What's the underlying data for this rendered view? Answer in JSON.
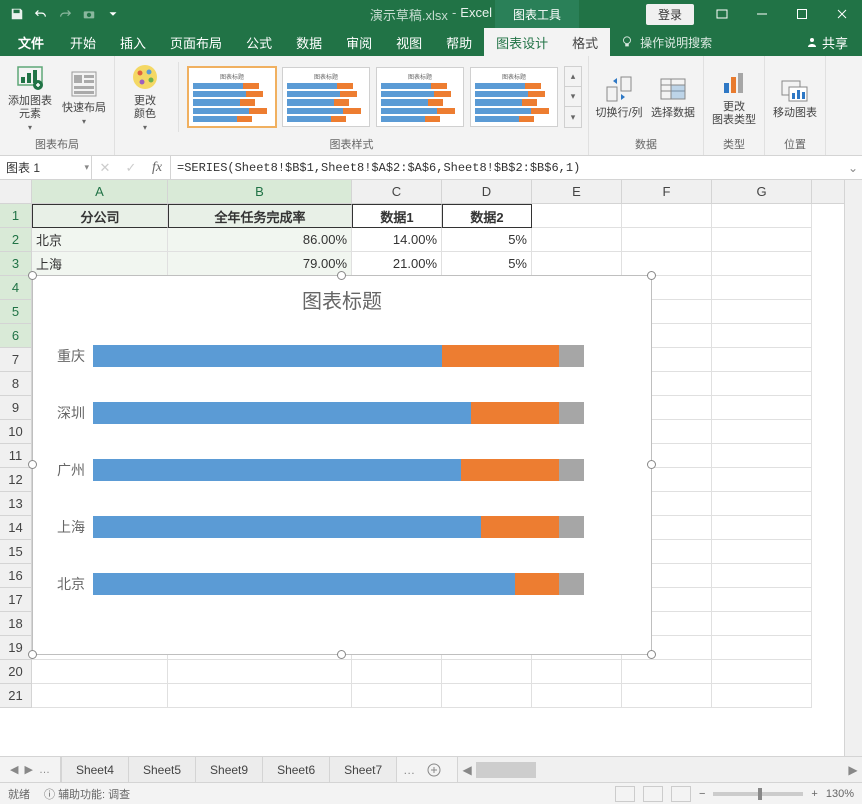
{
  "titlebar": {
    "filename": "演示草稿.xlsx",
    "app": "Excel",
    "chart_tools": "图表工具",
    "login": "登录"
  },
  "tabs": {
    "file": "文件",
    "home": "开始",
    "insert": "插入",
    "layout": "页面布局",
    "formulas": "公式",
    "data": "数据",
    "review": "审阅",
    "view": "视图",
    "help": "帮助",
    "chart_design": "图表设计",
    "format": "格式",
    "tell_me": "操作说明搜索",
    "share": "共享"
  },
  "ribbon": {
    "add_element": "添加图表\n元素",
    "quick_layout": "快速布局",
    "change_colors": "更改\n颜色",
    "switch_rowcol": "切换行/列",
    "select_data": "选择数据",
    "change_type": "更改\n图表类型",
    "move_chart": "移动图表",
    "group_layout": "图表布局",
    "group_styles": "图表样式",
    "group_data": "数据",
    "group_type": "类型",
    "group_location": "位置"
  },
  "formula_bar": {
    "name_box": "图表 1",
    "formula": "=SERIES(Sheet8!$B$1,Sheet8!$A$2:$A$6,Sheet8!$B$2:$B$6,1)"
  },
  "columns": [
    "A",
    "B",
    "C",
    "D",
    "E",
    "F",
    "G"
  ],
  "rows": [
    "1",
    "2",
    "3",
    "4",
    "5",
    "6",
    "7",
    "8",
    "9",
    "10",
    "11",
    "12",
    "13",
    "14",
    "15",
    "16",
    "17",
    "18",
    "19",
    "20",
    "21"
  ],
  "table": {
    "headers": [
      "分公司",
      "全年任务完成率",
      "数据1",
      "数据2"
    ],
    "r2": [
      "北京",
      "86.00%",
      "14.00%",
      "5%"
    ],
    "r3": [
      "上海",
      "79.00%",
      "21.00%",
      "5%"
    ]
  },
  "chart_data": {
    "type": "bar",
    "title": "图表标题",
    "categories": [
      "重庆",
      "深圳",
      "广州",
      "上海",
      "北京"
    ],
    "series": [
      {
        "name": "全年任务完成率",
        "values": [
          71,
          77,
          75,
          79,
          86
        ]
      },
      {
        "name": "数据1",
        "values": [
          24,
          18,
          20,
          16,
          9
        ]
      },
      {
        "name": "数据2",
        "values": [
          5,
          5,
          5,
          5,
          5
        ]
      }
    ],
    "xlabel": "",
    "ylabel": "",
    "xlim": [
      0,
      110
    ]
  },
  "sheet_tabs": [
    "Sheet4",
    "Sheet5",
    "Sheet9",
    "Sheet6",
    "Sheet7"
  ],
  "status": {
    "ready": "就绪",
    "acc": "辅助功能: 调查",
    "zoom": "130%"
  }
}
